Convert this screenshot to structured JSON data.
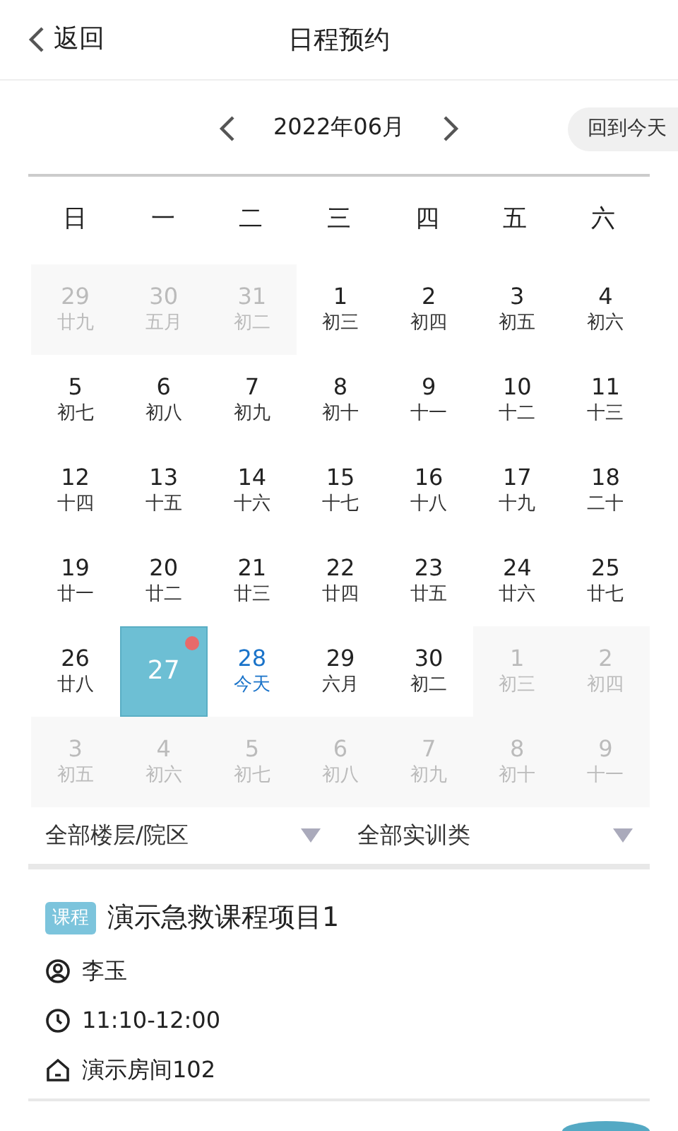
{
  "header": {
    "back_label": "返回",
    "title": "日程预约"
  },
  "month_nav": {
    "month": "2022年06月",
    "today_button": "回到今天"
  },
  "weekdays": [
    "日",
    "一",
    "二",
    "三",
    "四",
    "五",
    "六"
  ],
  "days": [
    {
      "day": "29",
      "lunar": "廿九",
      "in_month": false,
      "selected": false,
      "today": false,
      "has_event": false
    },
    {
      "day": "30",
      "lunar": "五月",
      "in_month": false,
      "selected": false,
      "today": false,
      "has_event": false
    },
    {
      "day": "31",
      "lunar": "初二",
      "in_month": false,
      "selected": false,
      "today": false,
      "has_event": false
    },
    {
      "day": "1",
      "lunar": "初三",
      "in_month": true,
      "selected": false,
      "today": false,
      "has_event": false
    },
    {
      "day": "2",
      "lunar": "初四",
      "in_month": true,
      "selected": false,
      "today": false,
      "has_event": false
    },
    {
      "day": "3",
      "lunar": "初五",
      "in_month": true,
      "selected": false,
      "today": false,
      "has_event": false
    },
    {
      "day": "4",
      "lunar": "初六",
      "in_month": true,
      "selected": false,
      "today": false,
      "has_event": false
    },
    {
      "day": "5",
      "lunar": "初七",
      "in_month": true,
      "selected": false,
      "today": false,
      "has_event": false
    },
    {
      "day": "6",
      "lunar": "初八",
      "in_month": true,
      "selected": false,
      "today": false,
      "has_event": false
    },
    {
      "day": "7",
      "lunar": "初九",
      "in_month": true,
      "selected": false,
      "today": false,
      "has_event": false
    },
    {
      "day": "8",
      "lunar": "初十",
      "in_month": true,
      "selected": false,
      "today": false,
      "has_event": false
    },
    {
      "day": "9",
      "lunar": "十一",
      "in_month": true,
      "selected": false,
      "today": false,
      "has_event": false
    },
    {
      "day": "10",
      "lunar": "十二",
      "in_month": true,
      "selected": false,
      "today": false,
      "has_event": false
    },
    {
      "day": "11",
      "lunar": "十三",
      "in_month": true,
      "selected": false,
      "today": false,
      "has_event": false
    },
    {
      "day": "12",
      "lunar": "十四",
      "in_month": true,
      "selected": false,
      "today": false,
      "has_event": false
    },
    {
      "day": "13",
      "lunar": "十五",
      "in_month": true,
      "selected": false,
      "today": false,
      "has_event": false
    },
    {
      "day": "14",
      "lunar": "十六",
      "in_month": true,
      "selected": false,
      "today": false,
      "has_event": false
    },
    {
      "day": "15",
      "lunar": "十七",
      "in_month": true,
      "selected": false,
      "today": false,
      "has_event": false
    },
    {
      "day": "16",
      "lunar": "十八",
      "in_month": true,
      "selected": false,
      "today": false,
      "has_event": false
    },
    {
      "day": "17",
      "lunar": "十九",
      "in_month": true,
      "selected": false,
      "today": false,
      "has_event": false
    },
    {
      "day": "18",
      "lunar": "二十",
      "in_month": true,
      "selected": false,
      "today": false,
      "has_event": false
    },
    {
      "day": "19",
      "lunar": "廿一",
      "in_month": true,
      "selected": false,
      "today": false,
      "has_event": false
    },
    {
      "day": "20",
      "lunar": "廿二",
      "in_month": true,
      "selected": false,
      "today": false,
      "has_event": false
    },
    {
      "day": "21",
      "lunar": "廿三",
      "in_month": true,
      "selected": false,
      "today": false,
      "has_event": false
    },
    {
      "day": "22",
      "lunar": "廿四",
      "in_month": true,
      "selected": false,
      "today": false,
      "has_event": false
    },
    {
      "day": "23",
      "lunar": "廿五",
      "in_month": true,
      "selected": false,
      "today": false,
      "has_event": false
    },
    {
      "day": "24",
      "lunar": "廿六",
      "in_month": true,
      "selected": false,
      "today": false,
      "has_event": false
    },
    {
      "day": "25",
      "lunar": "廿七",
      "in_month": true,
      "selected": false,
      "today": false,
      "has_event": false
    },
    {
      "day": "26",
      "lunar": "廿八",
      "in_month": true,
      "selected": false,
      "today": false,
      "has_event": false
    },
    {
      "day": "27",
      "in_month": true,
      "selected": true,
      "today": false,
      "has_event": true
    },
    {
      "day": "28",
      "lunar": "今天",
      "in_month": true,
      "selected": false,
      "today": true,
      "has_event": false
    },
    {
      "day": "29",
      "lunar": "六月",
      "in_month": true,
      "selected": false,
      "today": false,
      "has_event": false
    },
    {
      "day": "30",
      "lunar": "初二",
      "in_month": true,
      "selected": false,
      "today": false,
      "has_event": false
    },
    {
      "day": "1",
      "lunar": "初三",
      "in_month": false,
      "selected": false,
      "today": false,
      "has_event": false
    },
    {
      "day": "2",
      "lunar": "初四",
      "in_month": false,
      "selected": false,
      "today": false,
      "has_event": false
    },
    {
      "day": "3",
      "lunar": "初五",
      "in_month": false,
      "selected": false,
      "today": false,
      "has_event": false
    },
    {
      "day": "4",
      "lunar": "初六",
      "in_month": false,
      "selected": false,
      "today": false,
      "has_event": false
    },
    {
      "day": "5",
      "lunar": "初七",
      "in_month": false,
      "selected": false,
      "today": false,
      "has_event": false
    },
    {
      "day": "6",
      "lunar": "初八",
      "in_month": false,
      "selected": false,
      "today": false,
      "has_event": false
    },
    {
      "day": "7",
      "lunar": "初九",
      "in_month": false,
      "selected": false,
      "today": false,
      "has_event": false
    },
    {
      "day": "8",
      "lunar": "初十",
      "in_month": false,
      "selected": false,
      "today": false,
      "has_event": false
    },
    {
      "day": "9",
      "lunar": "十一",
      "in_month": false,
      "selected": false,
      "today": false,
      "has_event": false
    }
  ],
  "filters": [
    {
      "label": "全部楼层/院区"
    },
    {
      "label": "全部实训类"
    }
  ],
  "events": [
    {
      "tag": "课程",
      "title": "演示急救课程项目1",
      "teacher": "李玉",
      "time": "11:10-12:00",
      "room": "演示房间102"
    }
  ]
}
